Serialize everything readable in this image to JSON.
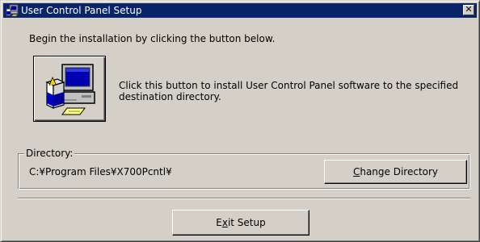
{
  "window": {
    "title": "User Control Panel Setup",
    "close_label": "✕"
  },
  "content": {
    "intro": "Begin the installation by clicking the button below.",
    "install_description_line1": "Click this button to install User Control Panel software to the specified",
    "install_description_line2": "destination directory."
  },
  "directory": {
    "group_label": "Directory:",
    "path": "C:¥Program Files¥X700Pcntl¥",
    "change_button": {
      "mnemonic": "C",
      "rest": "hange Directory"
    }
  },
  "footer": {
    "exit_button": {
      "before": "E",
      "mnemonic": "x",
      "rest": "it Setup"
    }
  },
  "colors": {
    "titlebar": "#0a246a",
    "face": "#d4d0c8"
  }
}
